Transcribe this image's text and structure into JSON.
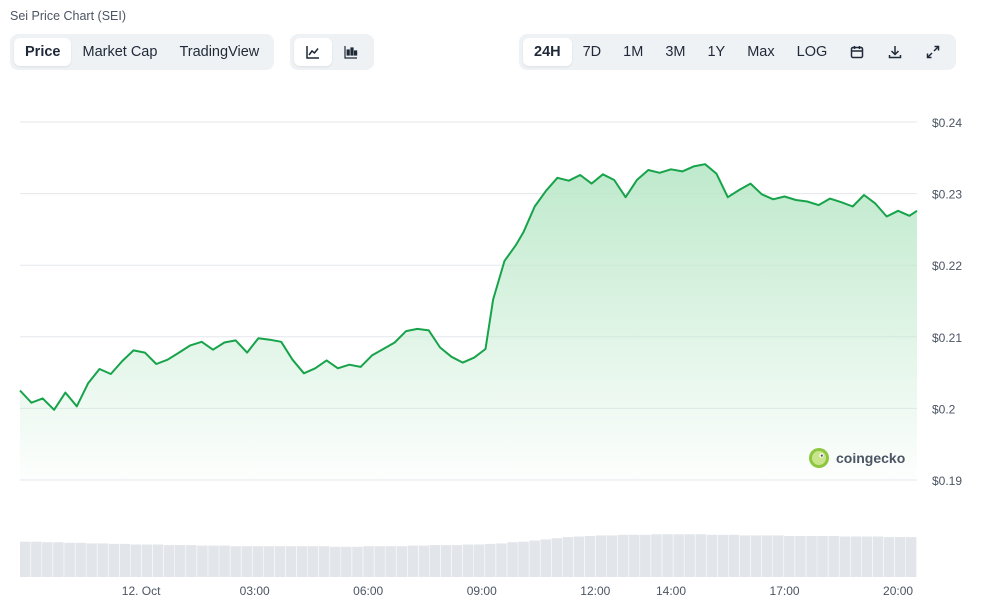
{
  "title": "Sei Price Chart (SEI)",
  "view_tabs": [
    {
      "label": "Price",
      "active": true
    },
    {
      "label": "Market Cap",
      "active": false
    },
    {
      "label": "TradingView",
      "active": false
    }
  ],
  "chart_type_icons": [
    {
      "icon": "line-chart-icon",
      "active": true
    },
    {
      "icon": "candlestick-chart-icon",
      "active": false
    }
  ],
  "range_tabs": [
    {
      "label": "24H",
      "active": true
    },
    {
      "label": "7D",
      "active": false
    },
    {
      "label": "1M",
      "active": false
    },
    {
      "label": "3M",
      "active": false
    },
    {
      "label": "1Y",
      "active": false
    },
    {
      "label": "Max",
      "active": false
    },
    {
      "label": "LOG",
      "active": false
    }
  ],
  "toolbar_icons": [
    "calendar-icon",
    "download-icon",
    "expand-icon"
  ],
  "watermark": "coingecko",
  "colors": {
    "line": "#16a34a",
    "area_top": "#bbe8c9",
    "grid": "#e5e7eb",
    "volume": "#e2e5e9",
    "accent_bg": "#eff2f5"
  },
  "chart_data": {
    "type": "area",
    "ylim": [
      0.19,
      0.24
    ],
    "ytick_values": [
      0.19,
      0.2,
      0.21,
      0.22,
      0.23,
      0.24
    ],
    "ytick_labels": [
      "$0.19",
      "$0.2",
      "$0.21",
      "$0.22",
      "$0.23",
      "$0.24"
    ],
    "xtick_labels": [
      "12. Oct",
      "03:00",
      "06:00",
      "09:00",
      "12:00",
      "14:00",
      "17:00",
      "20:00"
    ],
    "xtick_hours": [
      0,
      3,
      6,
      9,
      12,
      14,
      17,
      20
    ],
    "x_range_hours": [
      -3.2,
      20.5
    ],
    "series": [
      {
        "x": [
          -3.2,
          -2.9,
          -2.6,
          -2.3,
          -2.0,
          -1.7,
          -1.4,
          -1.1,
          -0.8,
          -0.5,
          -0.2,
          0.1,
          0.4,
          0.7,
          1.0,
          1.3,
          1.6,
          1.9,
          2.2,
          2.5,
          2.8,
          3.1,
          3.4,
          3.7,
          4.0,
          4.3,
          4.6,
          4.9,
          5.2,
          5.5,
          5.8,
          6.1,
          6.4,
          6.7,
          7.0,
          7.3,
          7.6,
          7.9,
          8.2,
          8.5,
          8.8,
          9.1,
          9.3,
          9.6,
          9.9,
          10.1,
          10.4,
          10.7,
          11.0,
          11.3,
          11.6,
          11.9,
          12.2,
          12.5,
          12.8,
          13.1,
          13.4,
          13.7,
          14.0,
          14.3,
          14.6,
          14.9,
          15.2,
          15.5,
          15.8,
          16.1,
          16.4,
          16.7,
          17.0,
          17.3,
          17.6,
          17.9,
          18.2,
          18.5,
          18.8,
          19.1,
          19.4,
          19.7,
          20.0,
          20.3,
          20.5
        ],
        "values": [
          0.2025,
          0.2008,
          0.2014,
          0.1998,
          0.2022,
          0.2003,
          0.2035,
          0.2055,
          0.2048,
          0.2066,
          0.2081,
          0.2078,
          0.2062,
          0.2068,
          0.2078,
          0.2088,
          0.2093,
          0.2082,
          0.2092,
          0.2095,
          0.2078,
          0.2098,
          0.2096,
          0.2093,
          0.2068,
          0.2049,
          0.2056,
          0.2067,
          0.2056,
          0.2061,
          0.2058,
          0.2074,
          0.2083,
          0.2092,
          0.2108,
          0.2111,
          0.2109,
          0.2085,
          0.2072,
          0.2064,
          0.2071,
          0.2083,
          0.2152,
          0.2206,
          0.2228,
          0.2246,
          0.2282,
          0.2304,
          0.2322,
          0.2318,
          0.2326,
          0.2314,
          0.2327,
          0.2319,
          0.2295,
          0.2319,
          0.2333,
          0.2329,
          0.2334,
          0.2331,
          0.2338,
          0.2341,
          0.2328,
          0.2295,
          0.2305,
          0.2314,
          0.2299,
          0.2292,
          0.2296,
          0.2291,
          0.2289,
          0.2284,
          0.2293,
          0.2288,
          0.2282,
          0.2298,
          0.2286,
          0.2268,
          0.2276,
          0.2269,
          0.2276
        ]
      }
    ],
    "volume": [
      62,
      62,
      61,
      61,
      60,
      60,
      59,
      59,
      58,
      58,
      57,
      57,
      57,
      56,
      56,
      56,
      55,
      55,
      55,
      54,
      54,
      54,
      54,
      54,
      54,
      54,
      54,
      54,
      53,
      53,
      53,
      54,
      54,
      54,
      54,
      55,
      55,
      56,
      56,
      56,
      57,
      57,
      58,
      59,
      61,
      62,
      64,
      66,
      68,
      70,
      71,
      72,
      73,
      73,
      74,
      74,
      74,
      75,
      75,
      75,
      75,
      75,
      74,
      74,
      74,
      73,
      73,
      73,
      73,
      72,
      72,
      72,
      72,
      72,
      71,
      71,
      71,
      71,
      70,
      70,
      70
    ]
  }
}
